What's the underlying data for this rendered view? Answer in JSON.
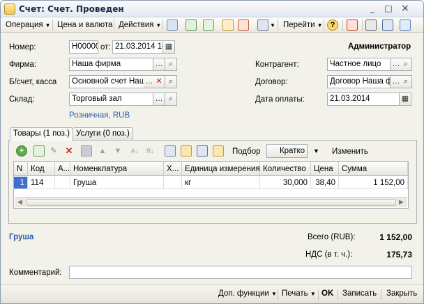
{
  "window": {
    "title": "Счет: Счет. Проведен",
    "controls": [
      "_",
      "□",
      "×"
    ]
  },
  "toolbar": {
    "operation": "Операция",
    "price_currency": "Цена и валюта",
    "actions": "Действия",
    "goto": "Перейти",
    "help": "?"
  },
  "header": {
    "user": "Администратор",
    "number_label": "Номер:",
    "number_value": "Н00000",
    "date_label": "от:",
    "date_value": "21.03.2014 14",
    "firm_label": "Фирма:",
    "firm_value": "Наша фирма",
    "account_label": "Б/счет, касса",
    "account_value": "Основной счет Наш...",
    "warehouse_label": "Склад:",
    "warehouse_value": "Торговый зал",
    "price_type_link": "Розничная, RUB",
    "contractor_label": "Контрагент:",
    "contractor_value": "Частное лицо",
    "contract_label": "Договор:",
    "contract_value": "Договор Наша ф",
    "paydate_label": "Дата оплаты:",
    "paydate_value": "21.03.2014"
  },
  "tabs": [
    {
      "label": "Товары (1 поз.)"
    },
    {
      "label": "Услуги (0 поз.)"
    }
  ],
  "grid_toolbar": {
    "pick": "Подбор",
    "mode": "Кратко",
    "change": "Изменить"
  },
  "table": {
    "columns": [
      "N",
      "Код",
      "А...",
      "Номенклатура",
      "Х...",
      "Единица измерения",
      "Количество",
      "Цена",
      "Сумма"
    ],
    "rows": [
      [
        "1",
        "114",
        "",
        "Груша",
        "",
        "кг",
        "30,000",
        "38,40",
        "1 152,00"
      ]
    ]
  },
  "summary": {
    "item_name": "Груша",
    "total_label": "Всего (RUB):",
    "total_value": "1 152,00",
    "vat_label": "НДС (в т. ч.):",
    "vat_value": "175,73",
    "comment_label": "Комментарий:",
    "comment_value": ""
  },
  "bottom": {
    "extra_functions": "Доп. функции",
    "print": "Печать",
    "ok": "OK",
    "save": "Записать",
    "close": "Закрыть"
  },
  "colors": {
    "link": "#2a5db0",
    "selected_row": "#3d6fd1",
    "title_bg": "#e3e8f1"
  }
}
